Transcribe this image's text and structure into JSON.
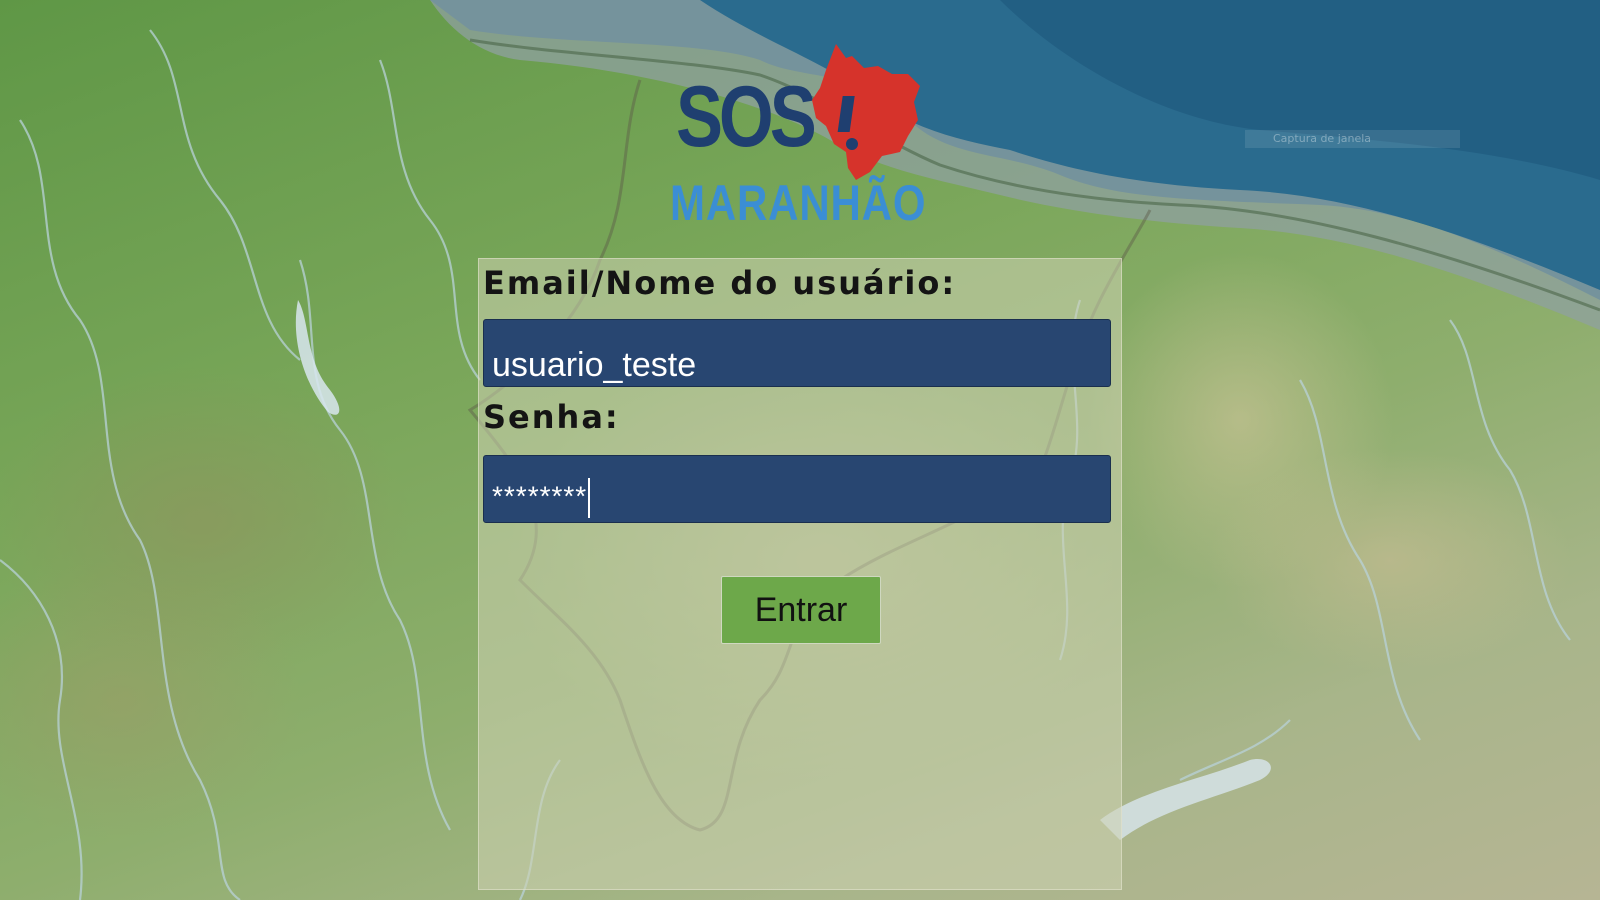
{
  "background": {
    "type": "terrain-map",
    "window_caption": "Captura de janela"
  },
  "logo": {
    "word_top": "SOS",
    "exclamation": "!",
    "word_bottom": "MARANHÃO",
    "colors": {
      "sos": "#1f3f70",
      "state_shape": "#d6332b",
      "name": "#3b8ed4"
    }
  },
  "login": {
    "username_label": "Email/Nome do usuário:",
    "username_value": "usuario_teste",
    "password_label": "Senha:",
    "password_value": "********",
    "submit_label": "Entrar",
    "colors": {
      "input_bg": "#284671",
      "button_bg": "#6da84a"
    }
  }
}
